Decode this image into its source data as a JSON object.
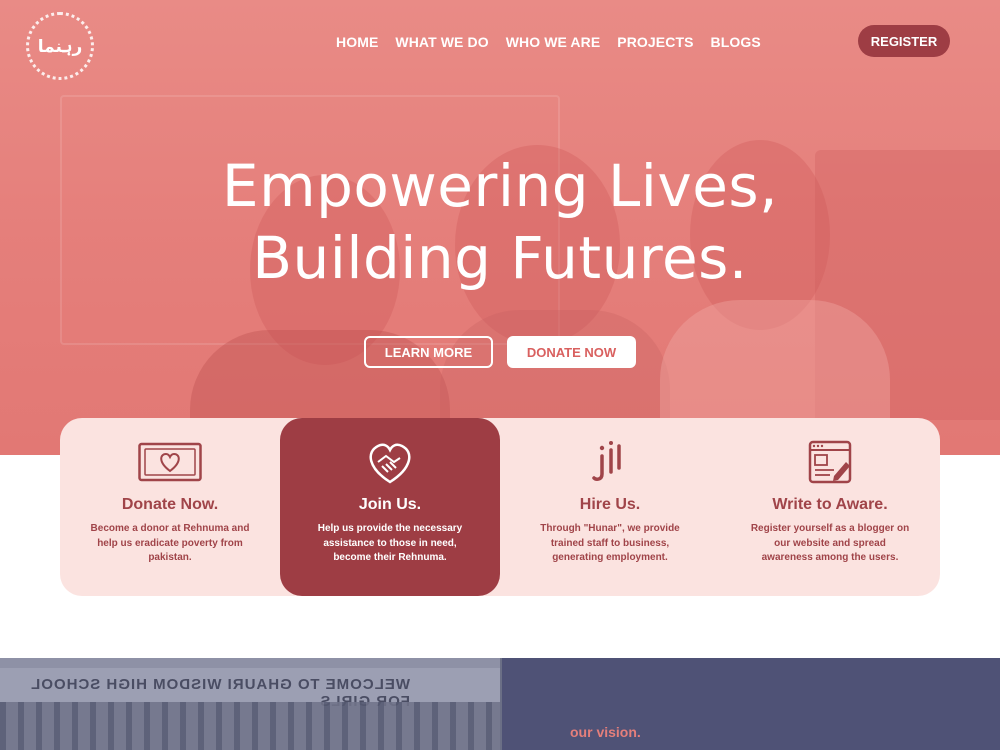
{
  "brand": {
    "logo_text": "رہنما"
  },
  "nav": {
    "items": [
      {
        "label": "HOME"
      },
      {
        "label": "WHAT WE DO"
      },
      {
        "label": "WHO WE ARE"
      },
      {
        "label": "PROJECTS"
      },
      {
        "label": "BLOGS"
      }
    ],
    "register_label": "REGISTER"
  },
  "hero": {
    "headline_line1": "Empowering Lives,",
    "headline_line2": "Building Futures.",
    "learn_more_label": "LEARN MORE",
    "donate_label": "DONATE NOW"
  },
  "cards": [
    {
      "icon": "money-heart-icon",
      "title": "Donate Now.",
      "text": "Become a donor at Rehnuma and help us eradicate poverty from pakistan."
    },
    {
      "icon": "handshake-heart-icon",
      "title": "Join Us.",
      "text": "Help us provide the necessary assistance to those in need, become their Rehnuma."
    },
    {
      "icon": "hunar-logo-icon",
      "title": "Hire Us.",
      "text": "Through \"Hunar\", we provide trained staff to business, generating employment."
    },
    {
      "icon": "blog-edit-icon",
      "title": "Write to Aware.",
      "text": "Register yourself as a blogger on our website and spread awareness among the users."
    }
  ],
  "bottom": {
    "sign_text": "WELCOME TO GHAURI WISDOM HIGH SCHOOL FOR GIRLS",
    "vision_title": "our vision."
  },
  "colors": {
    "hero_overlay": "#e57f7b",
    "accent_dark": "#9e3d44",
    "card_bg": "#fbe3e0",
    "vision_bg": "#4f5276"
  }
}
